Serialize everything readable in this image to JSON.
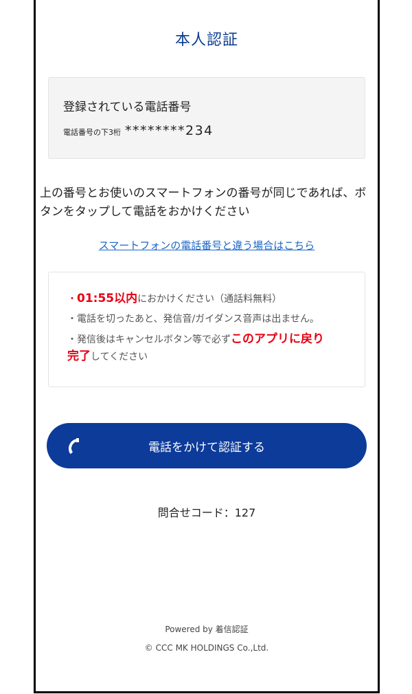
{
  "header": {
    "title": "本人認証"
  },
  "registered_phone": {
    "heading": "登録されている電話番号",
    "last3_label": "電話番号の下3桁",
    "masked_number": "********234"
  },
  "instruction": {
    "text": "上の番号とお使いのスマートフォンの番号が同じであれば、ボタンをタップして電話をおかけください"
  },
  "different_number_link": {
    "label": "スマートフォンの電話番号と違う場合はこちら"
  },
  "notice": {
    "line1_prefix": "・",
    "line1_time": "01:55以内",
    "line1_suffix": "におかけください（通話料無料）",
    "line2": "・電話を切ったあと、発信音/ガイダンス音声は出ません。",
    "line3_prefix": "・発信後はキャンセルボタン等で必ず",
    "line3_highlight1": "このアプリに戻り",
    "line3_highlight2": "完了",
    "line3_suffix": "してください"
  },
  "call_button": {
    "label": "電話をかけて認証する",
    "icon": "phone-handset-icon"
  },
  "inquiry": {
    "text": "問合せコード：127"
  },
  "footer": {
    "powered_by": "Powered by 着信認証",
    "copyright": "© CCC MK HOLDINGS Co.,Ltd."
  },
  "colors": {
    "title": "#0b3a8f",
    "button": "#0c3b9a",
    "highlight": "#e60012",
    "link": "#1a66c9"
  }
}
